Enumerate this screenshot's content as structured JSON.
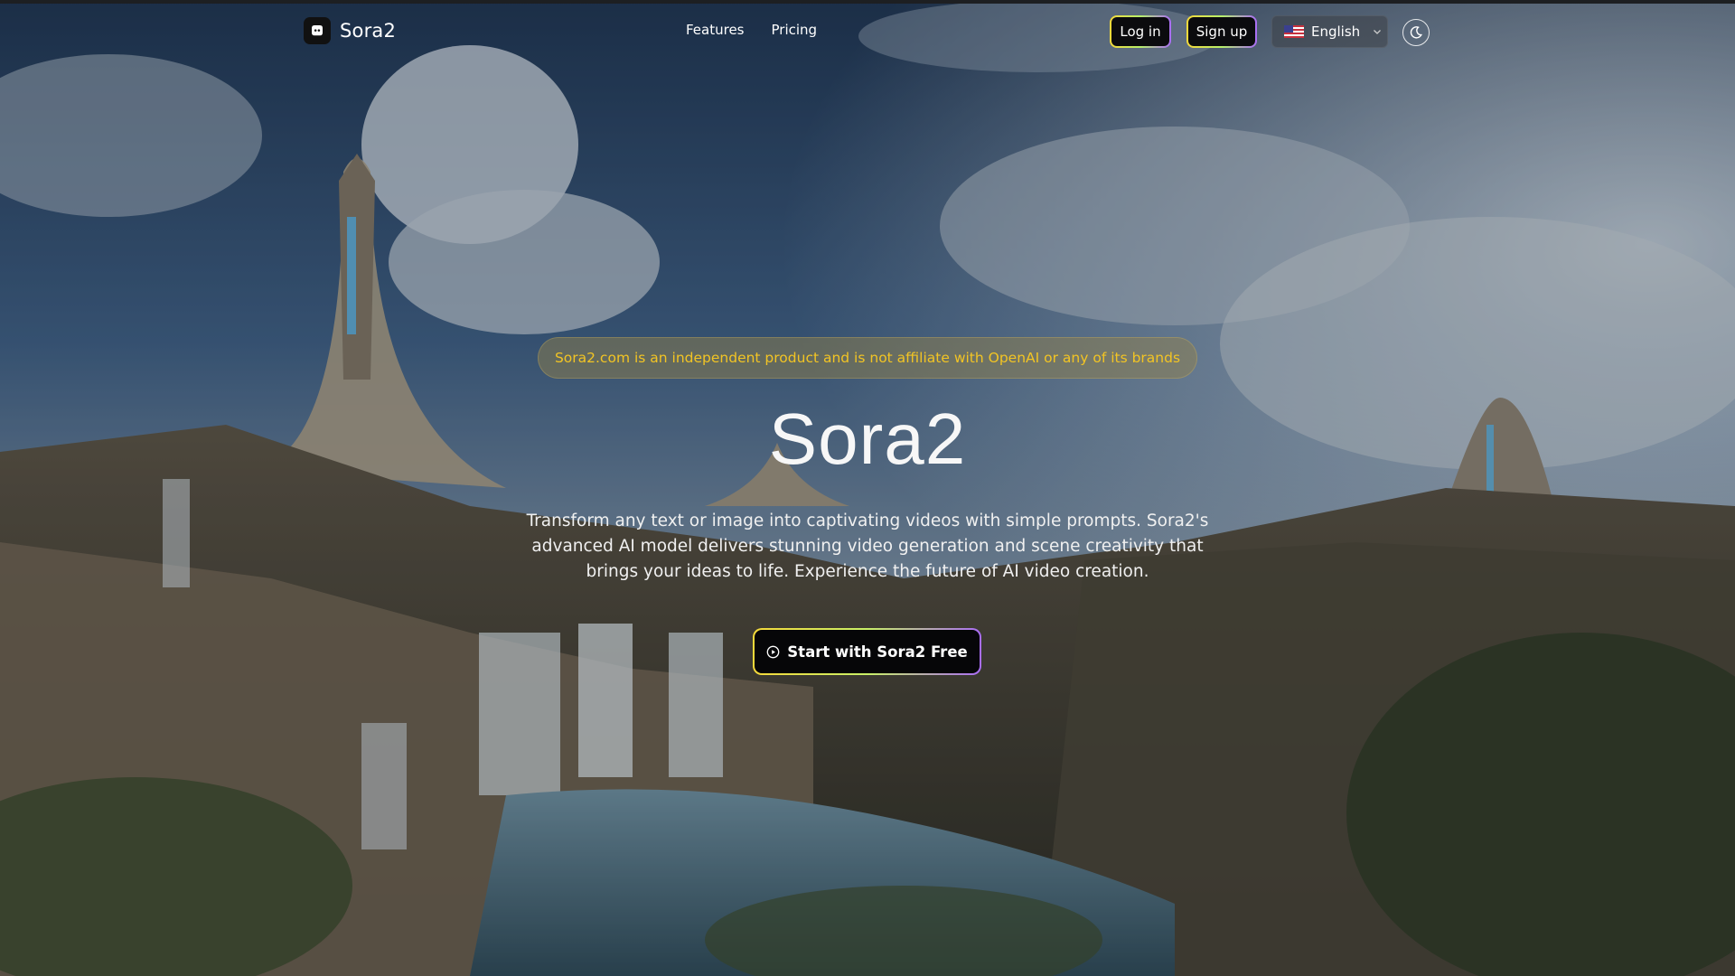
{
  "brand": {
    "name": "Sora2",
    "logo_icon": "discord-like-logo-icon"
  },
  "nav": {
    "links": [
      {
        "label": "Features"
      },
      {
        "label": "Pricing"
      }
    ],
    "login_label": "Log in",
    "signup_label": "Sign up",
    "language": {
      "label": "English",
      "flag_icon": "us-flag-icon",
      "chevron_icon": "chevron-down-icon"
    },
    "theme_icon": "moon-icon"
  },
  "hero": {
    "notice": "Sora2.com is an independent product and is not affiliate with OpenAI or any of its brands",
    "title": "Sora2",
    "description": "Transform any text or image into captivating videos with simple prompts. Sora2's advanced AI model delivers stunning video generation and scene creativity that brings your ideas to life. Experience the future of AI video creation.",
    "cta_label": "Start with Sora2 Free",
    "cta_icon": "play-circle-icon"
  },
  "colors": {
    "notice_text": "#f2c424",
    "cta_gradient": [
      "#f5d93a",
      "#c9f067",
      "#a96cf5"
    ],
    "button_bg": "#0b0b0e"
  }
}
